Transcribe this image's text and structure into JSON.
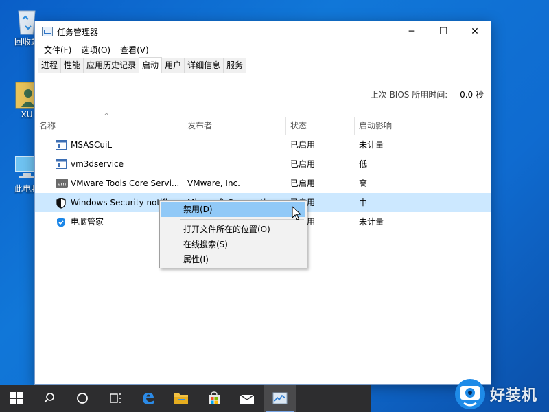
{
  "desktop": {
    "icons": [
      {
        "label": "回收站",
        "icon": "recycle-bin-icon"
      },
      {
        "label": "XU",
        "icon": "user-folder-icon"
      },
      {
        "label": "此电脑",
        "icon": "computer-icon"
      }
    ]
  },
  "window": {
    "title": "任务管理器",
    "menu": [
      "文件(F)",
      "选项(O)",
      "查看(V)"
    ],
    "tabs": [
      "进程",
      "性能",
      "应用历史记录",
      "启动",
      "用户",
      "详细信息",
      "服务"
    ],
    "active_tab": "启动",
    "bios": {
      "label": "上次 BIOS 所用时间:",
      "value": "0.0 秒"
    },
    "columns": [
      "名称",
      "发布者",
      "状态",
      "启动影响"
    ],
    "rows": [
      {
        "name": "MSASCuiL",
        "publisher": "",
        "status": "已启用",
        "impact": "未计量",
        "icon": "app-window-icon"
      },
      {
        "name": "vm3dservice",
        "publisher": "",
        "status": "已启用",
        "impact": "低",
        "icon": "app-window-icon"
      },
      {
        "name": "VMware Tools Core Servi...",
        "publisher": "VMware, Inc.",
        "status": "已启用",
        "impact": "高",
        "icon": "vmware-icon"
      },
      {
        "name": "Windows Security notifi...",
        "publisher": "Microsoft Corporation",
        "status": "已启用",
        "impact": "中",
        "icon": "shield-icon",
        "selected": true
      },
      {
        "name": "电脑管家",
        "publisher": "",
        "status": "已启用",
        "impact": "未计量",
        "icon": "pc-manager-icon"
      }
    ]
  },
  "context_menu": {
    "items": [
      "禁用(D)",
      "打开文件所在的位置(O)",
      "在线搜索(S)",
      "属性(I)"
    ],
    "highlighted": "禁用(D)"
  },
  "taskbar": {
    "items": [
      "start-icon",
      "search-icon",
      "cortana-icon",
      "task-view-icon",
      "edge-icon",
      "file-explorer-icon",
      "store-icon",
      "mail-icon",
      "task-manager-icon"
    ],
    "active": "task-manager-icon"
  },
  "watermark": {
    "text": "好装机"
  },
  "colors": {
    "selected_row": "#cce8ff",
    "menu_highlight": "#91c9f7",
    "desktop": "#0f6bd0"
  }
}
